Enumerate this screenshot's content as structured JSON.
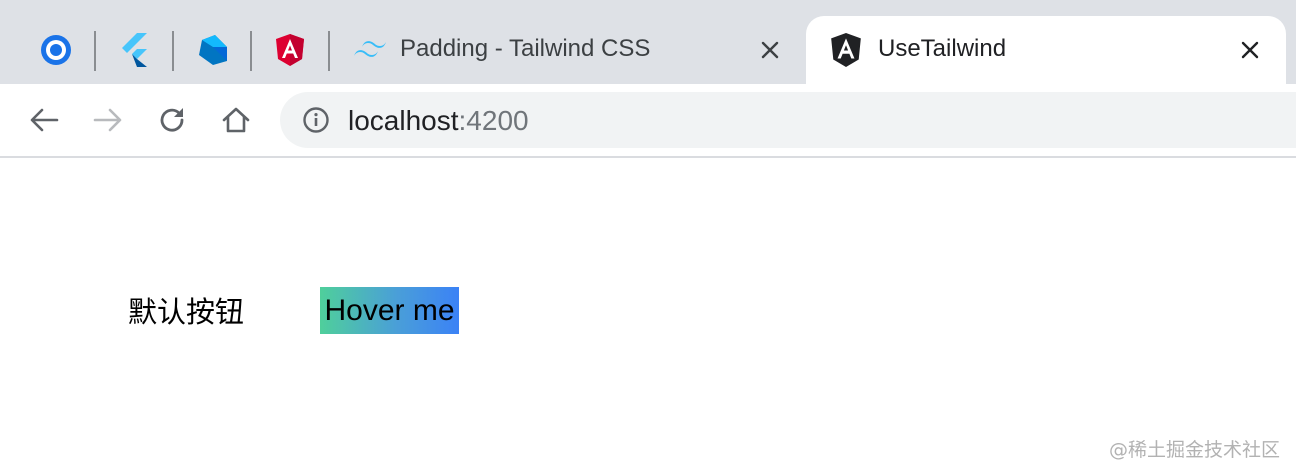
{
  "tabs": {
    "pinned": [
      {
        "icon": "circle-app-icon"
      },
      {
        "icon": "flutter-icon"
      },
      {
        "icon": "dart-icon"
      },
      {
        "icon": "angular-icon"
      }
    ],
    "items": [
      {
        "title": "Padding - Tailwind CSS",
        "icon": "tailwind-icon",
        "active": false
      },
      {
        "title": "UseTailwind",
        "icon": "angular-icon",
        "active": true
      }
    ]
  },
  "toolbar": {
    "url_host": "localhost",
    "url_port": ":4200"
  },
  "page": {
    "default_button_label": "默认按钮",
    "hover_button_label": "Hover me",
    "hover_gradient": [
      "#4fcf9b",
      "#3b82f6"
    ]
  },
  "watermark": "@稀土掘金技术社区",
  "colors": {
    "tabstrip_bg": "#dee1e6",
    "omnibox_bg": "#f1f3f4",
    "angular_red": "#dd0031",
    "tailwind_cyan": "#38bdf8"
  }
}
